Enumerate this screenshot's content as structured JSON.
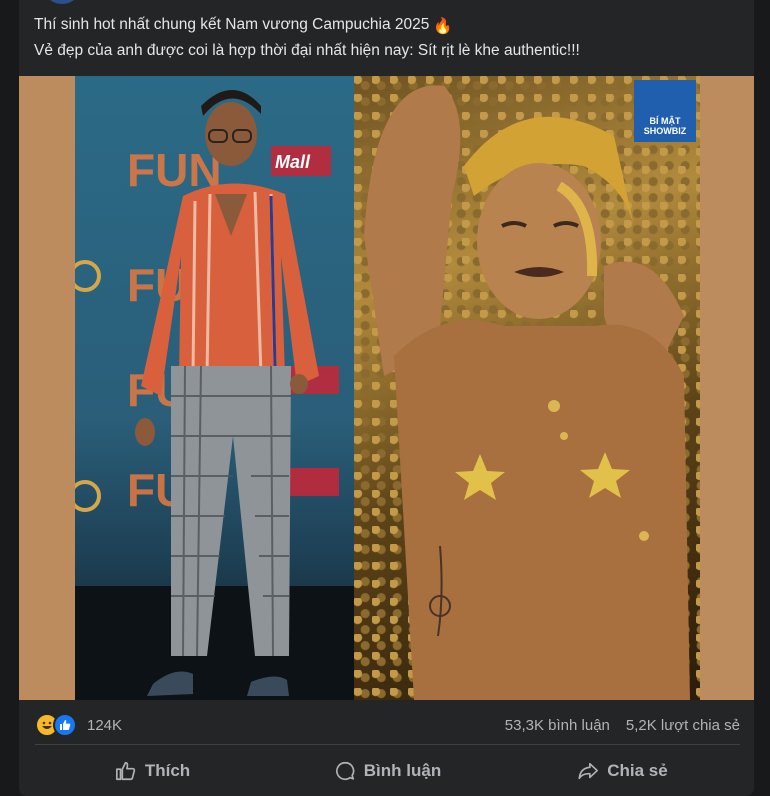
{
  "post": {
    "caption_line1": "Thí sinh hot nhất chung kết Nam vương Campuchia 2025",
    "caption_emoji": "🔥",
    "caption_line2": "Vẻ đẹp của anh được coi là hợp thời đại nhất hiện nay: Sít rịt lè khe authentic!!!",
    "watermark_line1": "BÍ MẬT",
    "watermark_line2": "SHOWBIZ",
    "backdrop_text": "FUN",
    "backdrop_brand": "Mall"
  },
  "reactions": {
    "icons": [
      "haha-icon",
      "like-icon"
    ],
    "count": "124K",
    "comments": "53,3K bình luận",
    "shares": "5,2K lượt chia sẻ"
  },
  "actions": {
    "like": "Thích",
    "comment": "Bình luận",
    "share": "Chia sẻ"
  },
  "colors": {
    "background": "#18191a",
    "card": "#242526",
    "text": "#e4e6eb",
    "muted": "#b0b3b8",
    "media_bg": "#bd8c5e",
    "like_blue": "#1877f2"
  }
}
